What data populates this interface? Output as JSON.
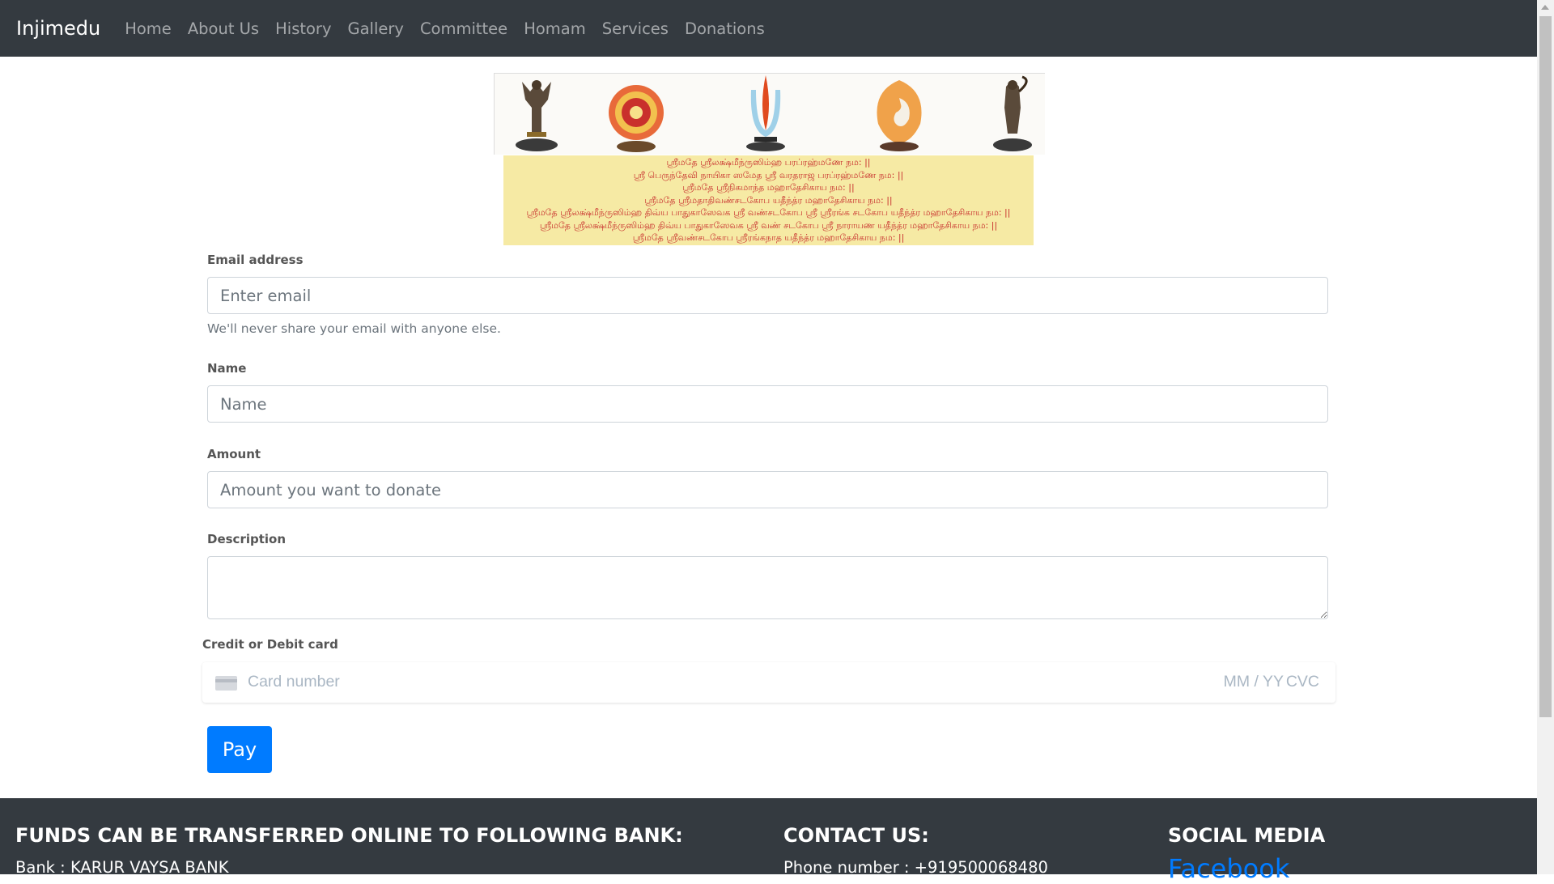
{
  "navbar": {
    "brand": "Injimedu",
    "links": [
      "Home",
      "About Us",
      "History",
      "Gallery",
      "Committee",
      "Homam",
      "Services",
      "Donations"
    ]
  },
  "banner": {
    "verses": [
      "ஸ்ரீமதே ஸ்ரீலக்ஷ்மீந்ருஸிம்ஹ பரப்ரஹ்மணே நம: ||",
      "ஸ்ரீ பெருந்தேவி நாயிகா ஸமேத ஸ்ரீ வரதராஜ பரப்ரஹ்மணே நம: ||",
      "ஸ்ரீமதே ஸ்ரீநிகமாந்த மஹாதேசிகாய நம: ||",
      "ஸ்ரீமதே ஸ்ரீமதாதிவண்சடகோப யதீந்த்ர மஹாதேசிகாய நம: ||",
      "ஸ்ரீமதே ஸ்ரீலக்ஷ்மீந்ருஸிம்ஹ திவ்ய பாதுகாஸேவக ஸ்ரீ வண்சடகோப ஸ்ரீ ஸ்ரீரங்க சடகோப யதீந்த்ர மஹாதேசிகாய நம: ||",
      "ஸ்ரீமதே ஸ்ரீலக்ஷ்மீந்ருஸிம்ஹ திவ்ய பாதுகாஸேவக ஸ்ரீ வண் சடகோப ஸ்ரீ நாராயண யதீந்த்ர மஹாதேசிகாய நம: ||",
      "ஸ்ரீமதே ஸ்ரீவண்சடகோப ஸ்ரீரங்கநாத யதீந்த்ர மஹாதேசிகாய நம: ||"
    ]
  },
  "form": {
    "email_label": "Email address",
    "email_placeholder": "Enter email",
    "email_help": "We'll never share your email with anyone else.",
    "name_label": "Name",
    "name_placeholder": "Name",
    "amount_label": "Amount",
    "amount_placeholder": "Amount you want to donate",
    "description_label": "Description",
    "card_label": "Credit or Debit card",
    "card_number_placeholder": "Card number",
    "card_expiry_placeholder": "MM / YY",
    "card_cvc_placeholder": "CVC",
    "pay_label": "Pay"
  },
  "footer": {
    "bank_heading": "FUNDS CAN BE TRANSFERRED ONLINE TO FOLLOWING BANK:",
    "bank_text": "Bank : KARUR VAYSA BANK",
    "contact_heading": "CONTACT US:",
    "contact_text": "Phone number : +919500068480",
    "social_heading": "SOCIAL MEDIA",
    "social_link": "Facebook"
  },
  "colors": {
    "navbar_bg": "#343a40",
    "primary": "#007bff",
    "verse_bg": "#f6eaa4",
    "verse_text": "#c8302e"
  }
}
